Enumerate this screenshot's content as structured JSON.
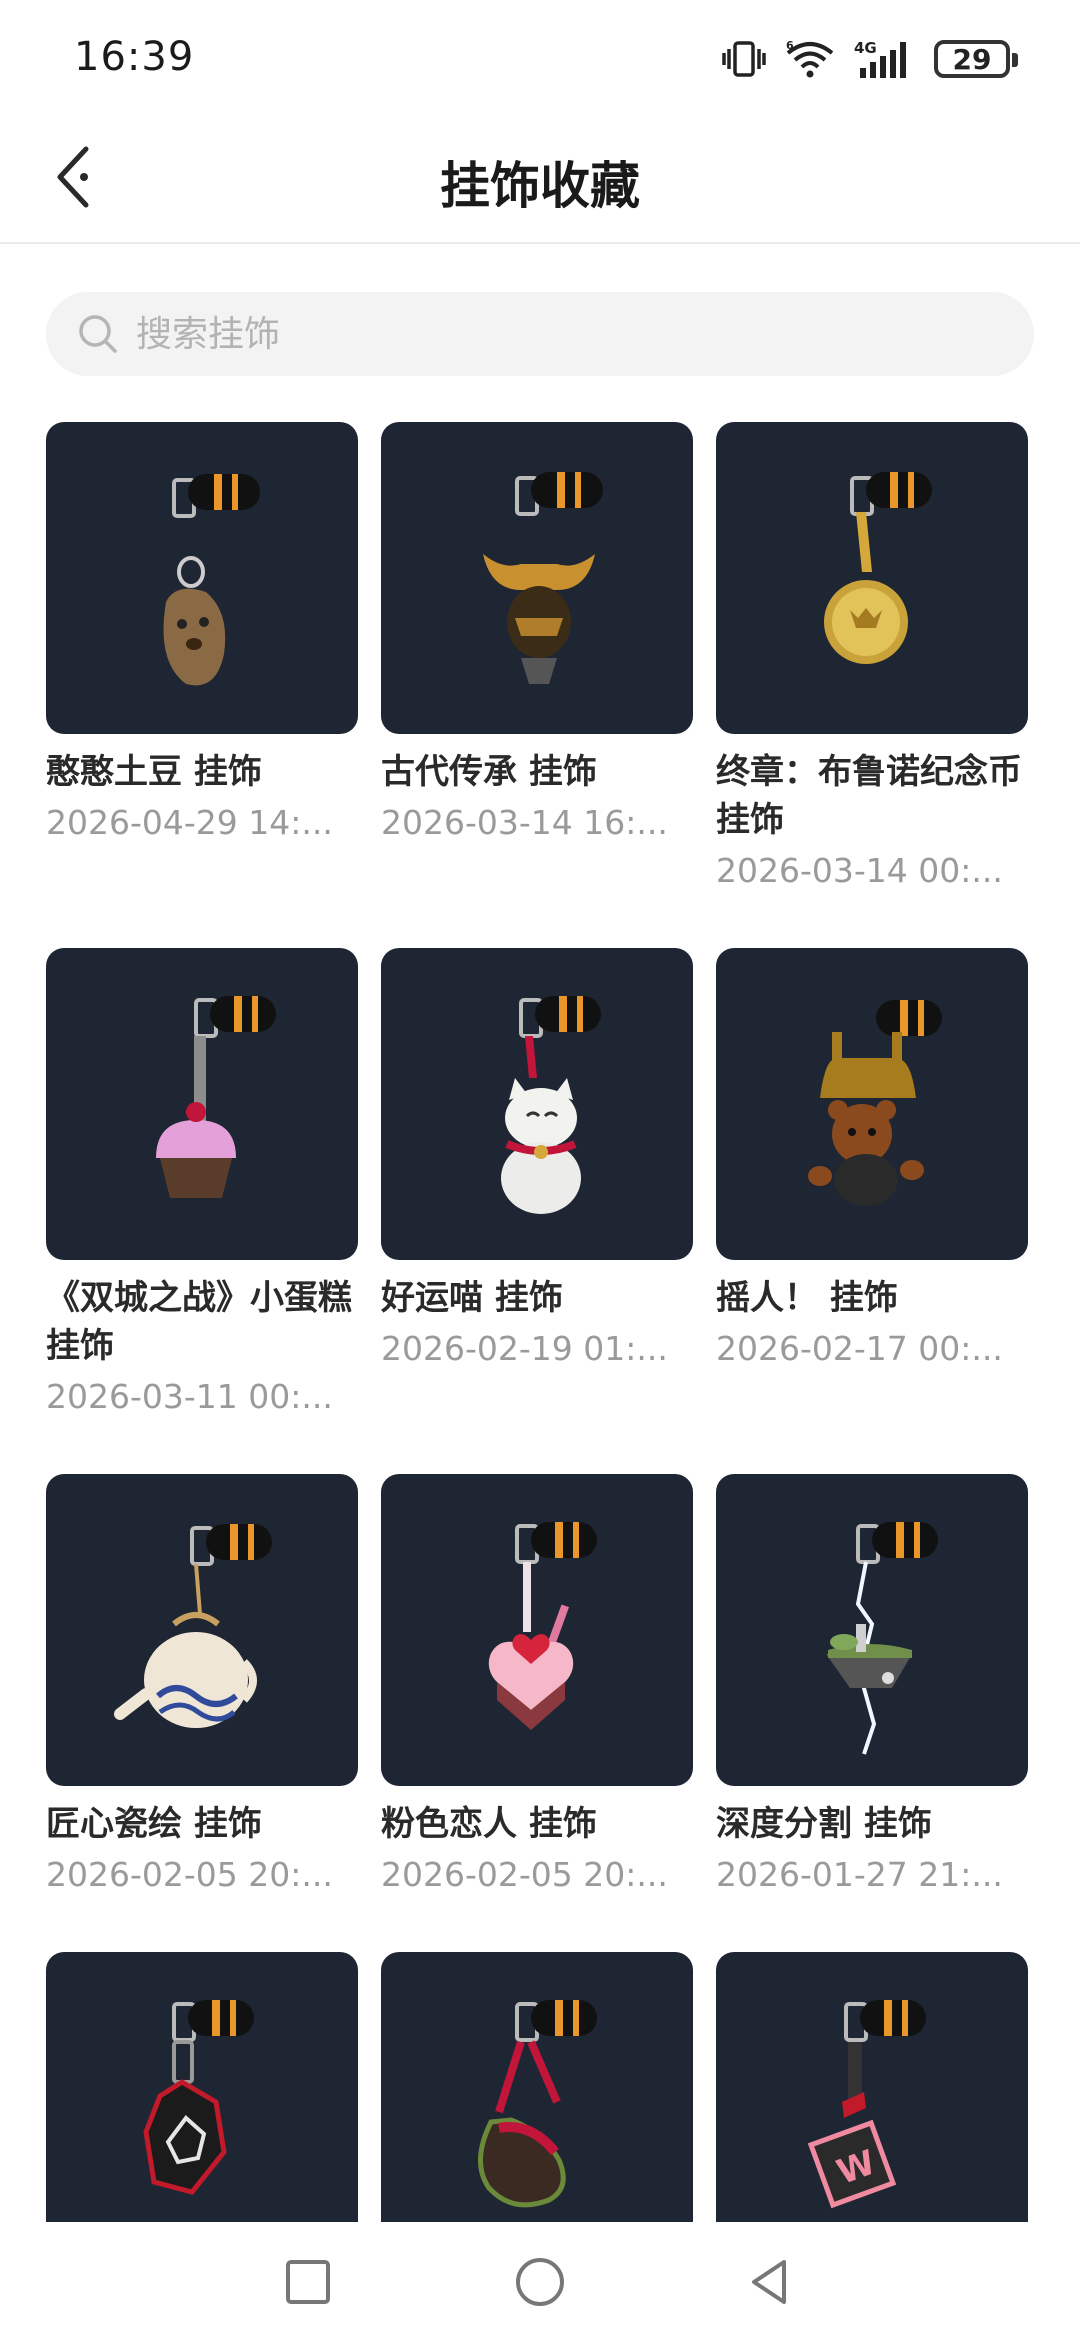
{
  "status_bar": {
    "time": "16:39",
    "network": "4G",
    "battery": "29",
    "icons": [
      "vibrate-icon",
      "wifi-icon",
      "signal-icon",
      "battery-icon"
    ]
  },
  "header": {
    "title": "挂饰收藏",
    "back_icon": "back-arrow-icon"
  },
  "search": {
    "placeholder": "搜索挂饰",
    "value": ""
  },
  "colors": {
    "thumb_bg": "#1e2533",
    "accent_orange": "#e9962b"
  },
  "items": [
    {
      "title": "憨憨土豆 挂饰",
      "date": "2026-04-29 14:...",
      "charm": "potato"
    },
    {
      "title": "古代传承 挂饰",
      "date": "2026-03-14 16:...",
      "charm": "samurai"
    },
    {
      "title": "终章：布鲁诺纪念币 挂饰",
      "date": "2026-03-14 00:...",
      "charm": "coin"
    },
    {
      "title": "《双城之战》小蛋糕 挂饰",
      "date": "2026-03-11 00:...",
      "charm": "cupcake"
    },
    {
      "title": "好运喵 挂饰",
      "date": "2026-02-19 01:...",
      "charm": "lucky-cat"
    },
    {
      "title": "摇人！ 挂饰",
      "date": "2026-02-17 00:...",
      "charm": "bear-bell"
    },
    {
      "title": "匠心瓷绘 挂饰",
      "date": "2026-02-05 20:...",
      "charm": "teapot"
    },
    {
      "title": "粉色恋人 挂饰",
      "date": "2026-02-05 20:...",
      "charm": "heart-cake"
    },
    {
      "title": "深度分割 挂饰",
      "date": "2026-01-27 21:...",
      "charm": "floating-island"
    },
    {
      "title": "",
      "date": "",
      "charm": "red-gem"
    },
    {
      "title": "",
      "date": "",
      "charm": "sandal"
    },
    {
      "title": "",
      "date": "",
      "charm": "w-cube"
    }
  ],
  "nav_bar": {
    "buttons": [
      "recent-apps-icon",
      "home-icon",
      "back-triangle-icon"
    ]
  }
}
